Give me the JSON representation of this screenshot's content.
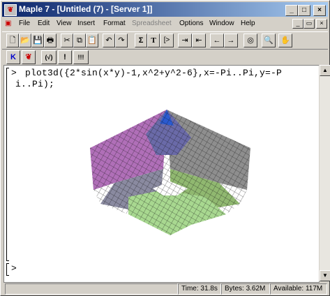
{
  "window": {
    "title": "Maple 7 - [Untitled (7) - [Server 1]]",
    "app_icon": "maple-leaf-icon"
  },
  "title_buttons": {
    "minimize": "_",
    "maximize": "□",
    "close": "×"
  },
  "menu": [
    {
      "label": "File",
      "enabled": true
    },
    {
      "label": "Edit",
      "enabled": true
    },
    {
      "label": "View",
      "enabled": true
    },
    {
      "label": "Insert",
      "enabled": true
    },
    {
      "label": "Format",
      "enabled": true
    },
    {
      "label": "Spreadsheet",
      "enabled": false
    },
    {
      "label": "Options",
      "enabled": true
    },
    {
      "label": "Window",
      "enabled": true
    },
    {
      "label": "Help",
      "enabled": true
    }
  ],
  "mdi_buttons": {
    "minimize": "_",
    "restore": "▭",
    "close": "×"
  },
  "toolbar": {
    "sigma": "Σ",
    "text": "T",
    "bracket": "[>",
    "back": "←",
    "forward": "→"
  },
  "toolbar2": {
    "k": "K",
    "paren": "(√)",
    "excl": "!",
    "excl2": "!!!"
  },
  "worksheet": {
    "prompt": ">",
    "input_line1": "plot3d({2*sin(x*y)-1,x^2+y^2-6},x=-Pi..Pi,y=-P",
    "input_line2": "i..Pi);",
    "empty_prompt": ">"
  },
  "status": {
    "time": "Time: 31.8s",
    "bytes": "Bytes: 3.62M",
    "available": "Available: 117M"
  },
  "colors": {
    "titlebar_start": "#0a246a",
    "titlebar_end": "#a6caf0",
    "chrome": "#d4d0c8"
  }
}
